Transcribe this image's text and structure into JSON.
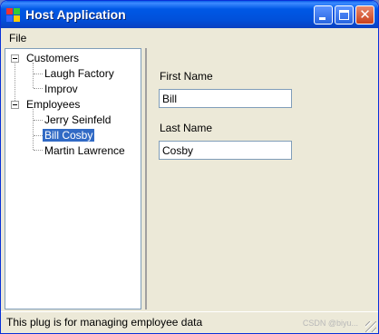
{
  "window": {
    "title": "Host Application"
  },
  "menu": {
    "items": [
      {
        "label": "File"
      }
    ]
  },
  "tree": {
    "groups": [
      {
        "label": "Customers",
        "expanded": true,
        "children": [
          {
            "label": "Laugh Factory"
          },
          {
            "label": "Improv"
          }
        ]
      },
      {
        "label": "Employees",
        "expanded": true,
        "children": [
          {
            "label": "Jerry Seinfeld"
          },
          {
            "label": "Bill Cosby",
            "selected": true
          },
          {
            "label": "Martin Lawrence"
          }
        ]
      }
    ]
  },
  "form": {
    "first_name": {
      "label": "First Name",
      "value": "Bill"
    },
    "last_name": {
      "label": "Last Name",
      "value": "Cosby"
    }
  },
  "status": {
    "text": "This plug is for managing employee data"
  },
  "watermark": {
    "text": "CSDN @biyu..."
  },
  "icons": {
    "app": "app-icon",
    "minimize": "minimize-icon",
    "maximize": "maximize-icon",
    "close": "close-icon",
    "expander": "collapse-icon",
    "grip": "resize-grip-icon"
  },
  "colors": {
    "titlebar": "#0054e3",
    "window_bg": "#ece9d8",
    "selection": "#316ac5",
    "close_button": "#d84b2a"
  }
}
